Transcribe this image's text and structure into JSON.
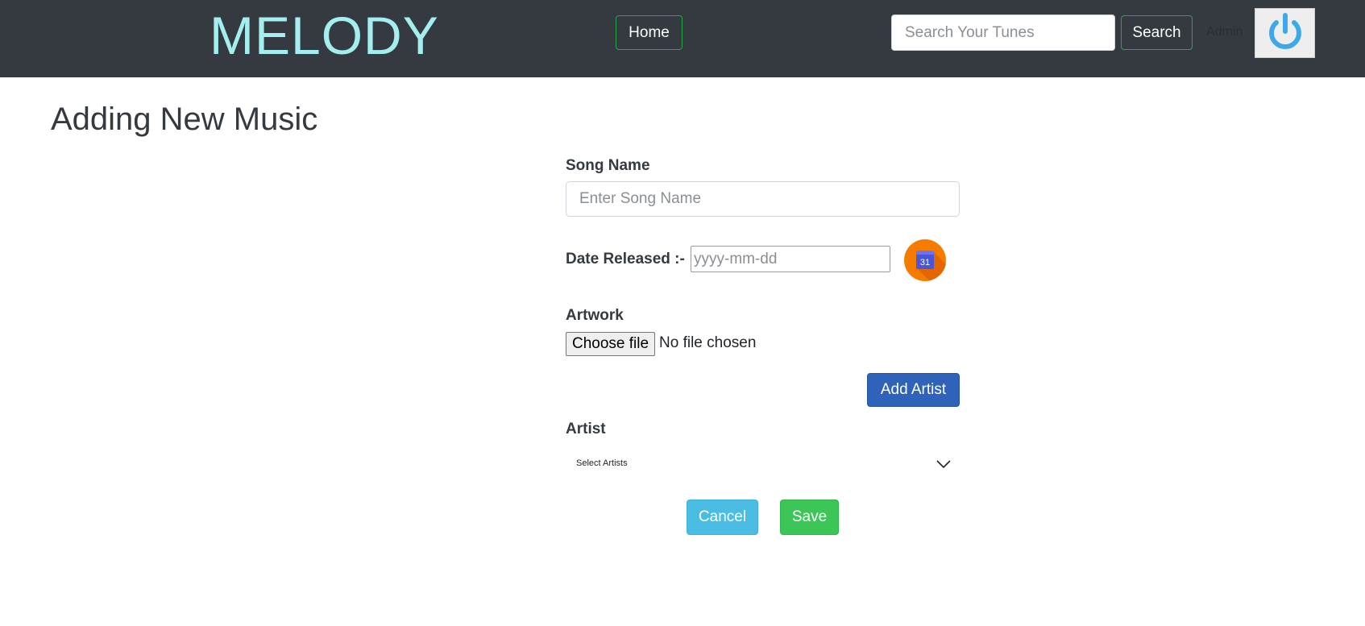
{
  "navbar": {
    "brand": "MELODY",
    "home_label": "Home",
    "search_placeholder": "Search Your Tunes",
    "search_label": "Search",
    "admin_label": "Admin",
    "power_icon": "power-icon"
  },
  "page": {
    "title": "Adding New Music"
  },
  "form": {
    "song_name_label": "Song Name",
    "song_name_placeholder": "Enter Song Name",
    "date_label": "Date Released :-",
    "date_placeholder": "yyyy-mm-dd",
    "calendar_icon": "calendar-icon",
    "calendar_day": "31",
    "artwork_label": "Artwork",
    "file_button_label": "Choose file",
    "file_status": "No file chosen",
    "add_artist_label": "Add Artist",
    "artist_label": "Artist",
    "artist_select_text": "Select Artists",
    "cancel_label": "Cancel",
    "save_label": "Save"
  },
  "colors": {
    "navbar_bg": "#343a40",
    "brand": "#a4eef0",
    "outline_green": "#28a745",
    "primary": "#2f62b9",
    "info": "#4bbde5",
    "success": "#3cc657",
    "calendar_orange": "#f57c00"
  }
}
